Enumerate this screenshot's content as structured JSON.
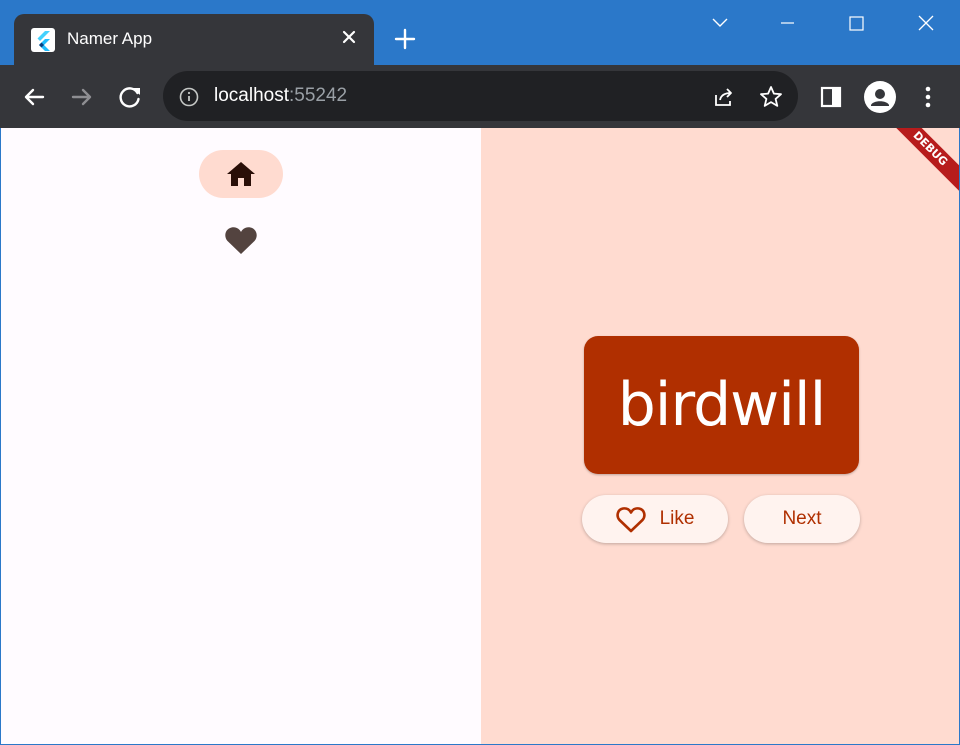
{
  "browser": {
    "tab": {
      "title": "Namer App",
      "favicon": "flutter-icon"
    },
    "url": {
      "host": "localhost",
      "port": ":55242"
    }
  },
  "rail": {
    "destinations": [
      {
        "icon": "home-icon",
        "selected": true
      },
      {
        "icon": "heart-icon",
        "selected": false
      }
    ]
  },
  "main": {
    "word": "birdwill",
    "like_label": "Like",
    "next_label": "Next"
  },
  "debug_banner": "DEBUG",
  "colors": {
    "primary": "#b02f00",
    "background": "#ffdbd0",
    "rail_background": "#fffbff",
    "browser_chrome": "#35363a",
    "title_bar": "#2b78c9"
  }
}
